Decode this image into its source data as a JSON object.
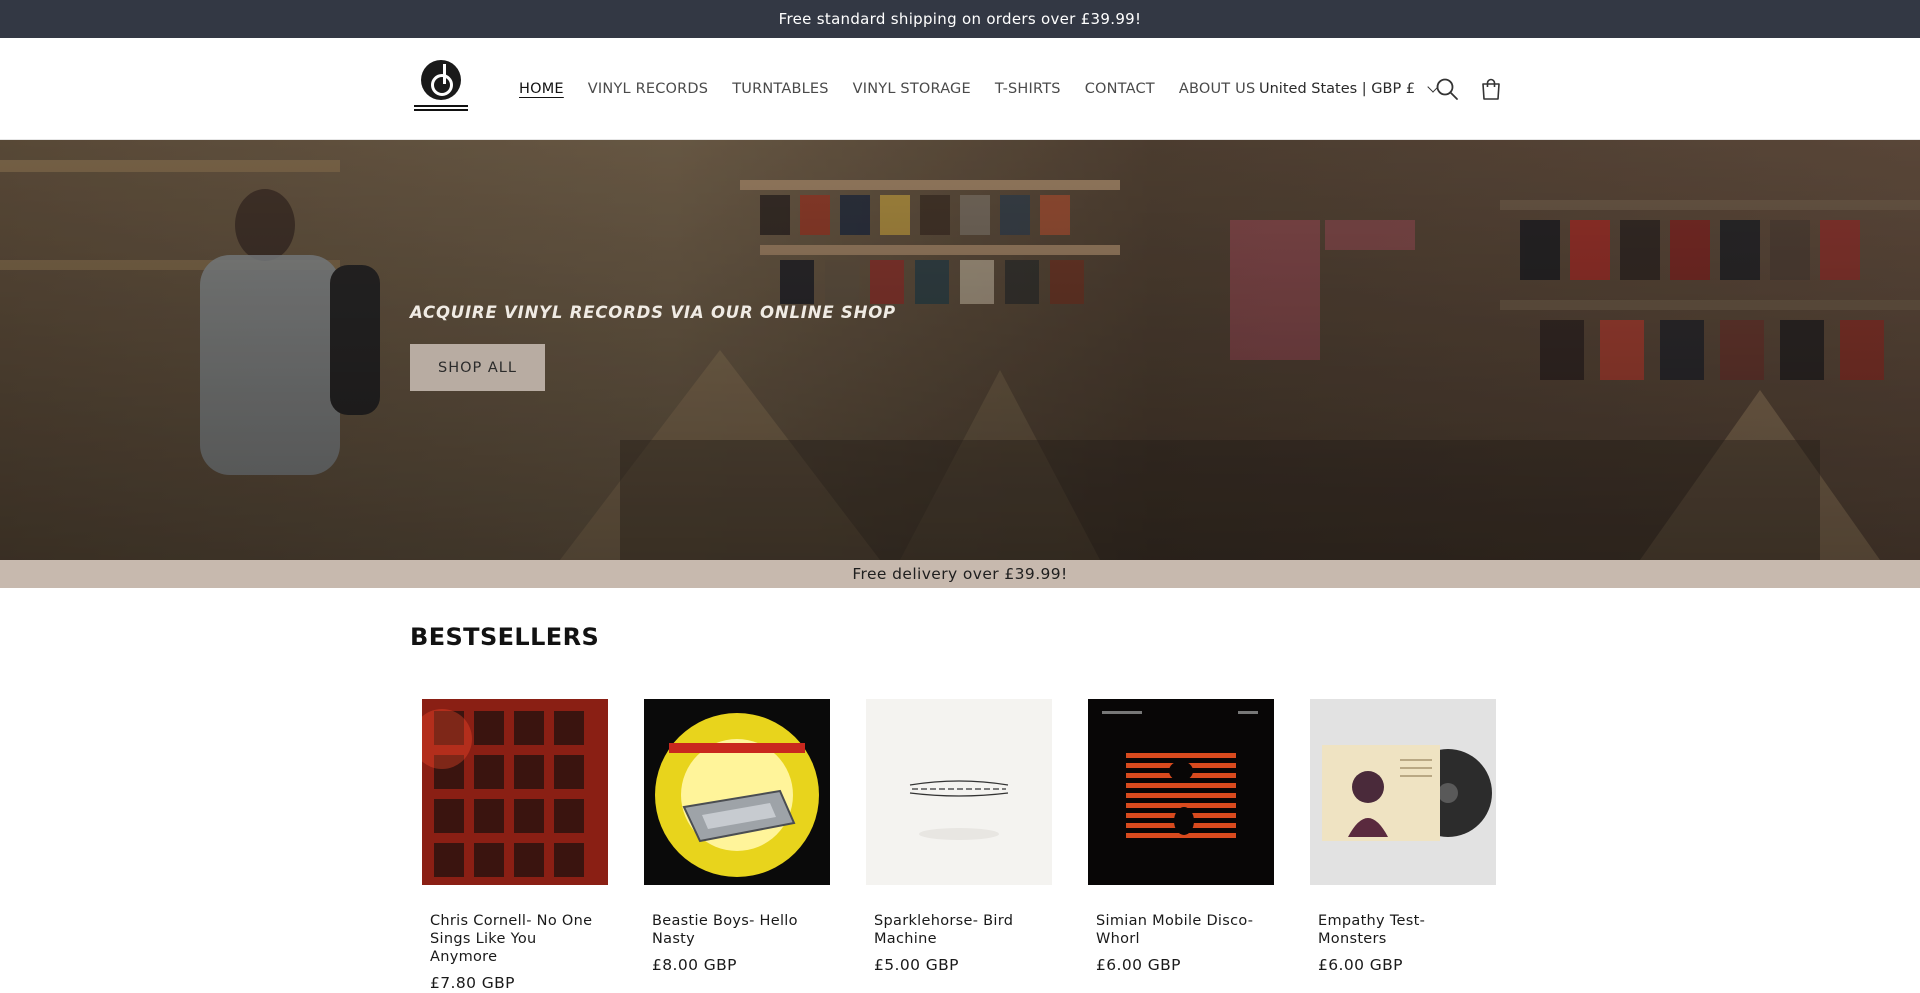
{
  "announcement": "Free standard shipping on orders over £39.99!",
  "nav": {
    "items": [
      {
        "label": "HOME",
        "active": true
      },
      {
        "label": "VINYL RECORDS",
        "active": false
      },
      {
        "label": "TURNTABLES",
        "active": false
      },
      {
        "label": "VINYL STORAGE",
        "active": false
      },
      {
        "label": "T-SHIRTS",
        "active": false
      },
      {
        "label": "CONTACT",
        "active": false
      },
      {
        "label": "ABOUT US",
        "active": false
      }
    ]
  },
  "header": {
    "locale": "United States | GBP £",
    "search_icon": "search-icon",
    "cart_icon": "cart-icon"
  },
  "hero": {
    "title": "ACQUIRE VINYL RECORDS VIA OUR ONLINE SHOP",
    "button": "SHOP ALL"
  },
  "delivery_bar": "Free delivery over £39.99!",
  "bestsellers": {
    "heading": "BESTSELLERS",
    "products": [
      {
        "title": "Chris Cornell- No One Sings Like You Anymore",
        "price": "£7.80 GBP"
      },
      {
        "title": "Beastie Boys- Hello Nasty",
        "price": "£8.00 GBP"
      },
      {
        "title": "Sparklehorse- Bird Machine",
        "price": "£5.00 GBP"
      },
      {
        "title": "Simian Mobile Disco- Whorl",
        "price": "£6.00 GBP"
      },
      {
        "title": "Empathy Test- Monsters",
        "price": "£6.00 GBP"
      }
    ]
  },
  "colors": {
    "announcement_bg": "#333844",
    "button_bg": "#b8aca2",
    "delivery_bg": "#c7b9ae"
  }
}
